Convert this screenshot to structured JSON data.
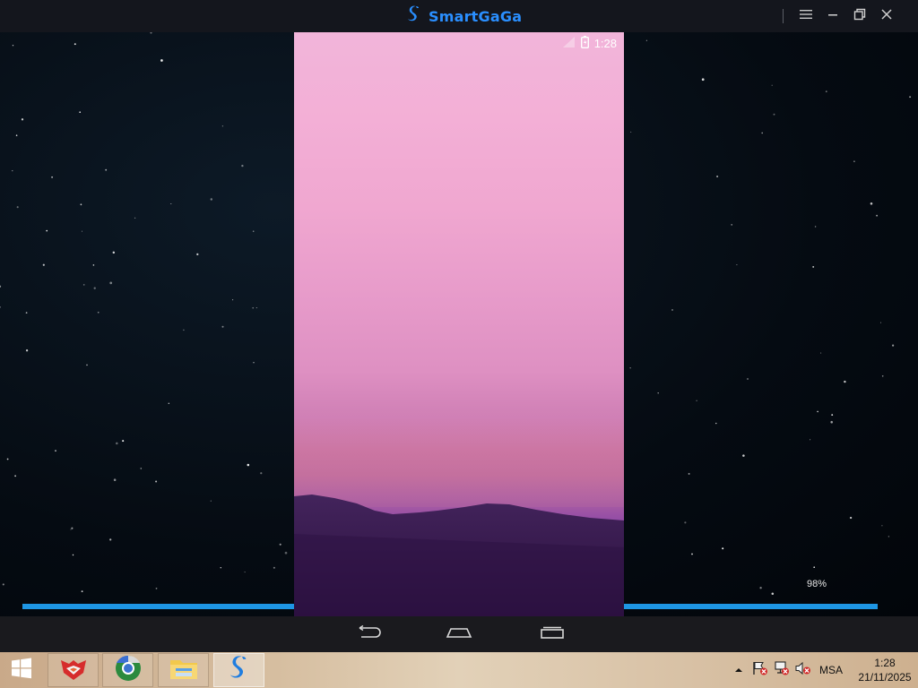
{
  "window": {
    "app_name": "SmartGaGa",
    "icons": {
      "brand": "swan-logo-icon",
      "menu": "hamburger-menu-icon",
      "minimize": "minimize-icon",
      "restore": "restore-icon",
      "close": "close-icon"
    },
    "accent": "#2a8fff"
  },
  "emulator": {
    "loading_percent": 98,
    "loading_label": "98%",
    "phone_status": {
      "time": "1:28",
      "icons": [
        "signal-icon",
        "battery-icon"
      ]
    },
    "nav_bar": {
      "buttons": [
        "back-icon",
        "home-icon",
        "recents-icon"
      ]
    }
  },
  "taskbar": {
    "start": "windows-logo-icon",
    "items": [
      {
        "name": "red-fox-app-icon",
        "active": false
      },
      {
        "name": "chrome-like-browser-icon",
        "active": false
      },
      {
        "name": "file-explorer-icon",
        "active": false
      },
      {
        "name": "smartgaga-icon",
        "active": true
      }
    ],
    "tray": {
      "icons": [
        "show-hidden-icons-chevron-icon",
        "action-center-flag-icon",
        "network-icon",
        "volume-muted-icon"
      ],
      "language": "MSA",
      "time": "1:28",
      "date": "21/11/2025"
    }
  }
}
